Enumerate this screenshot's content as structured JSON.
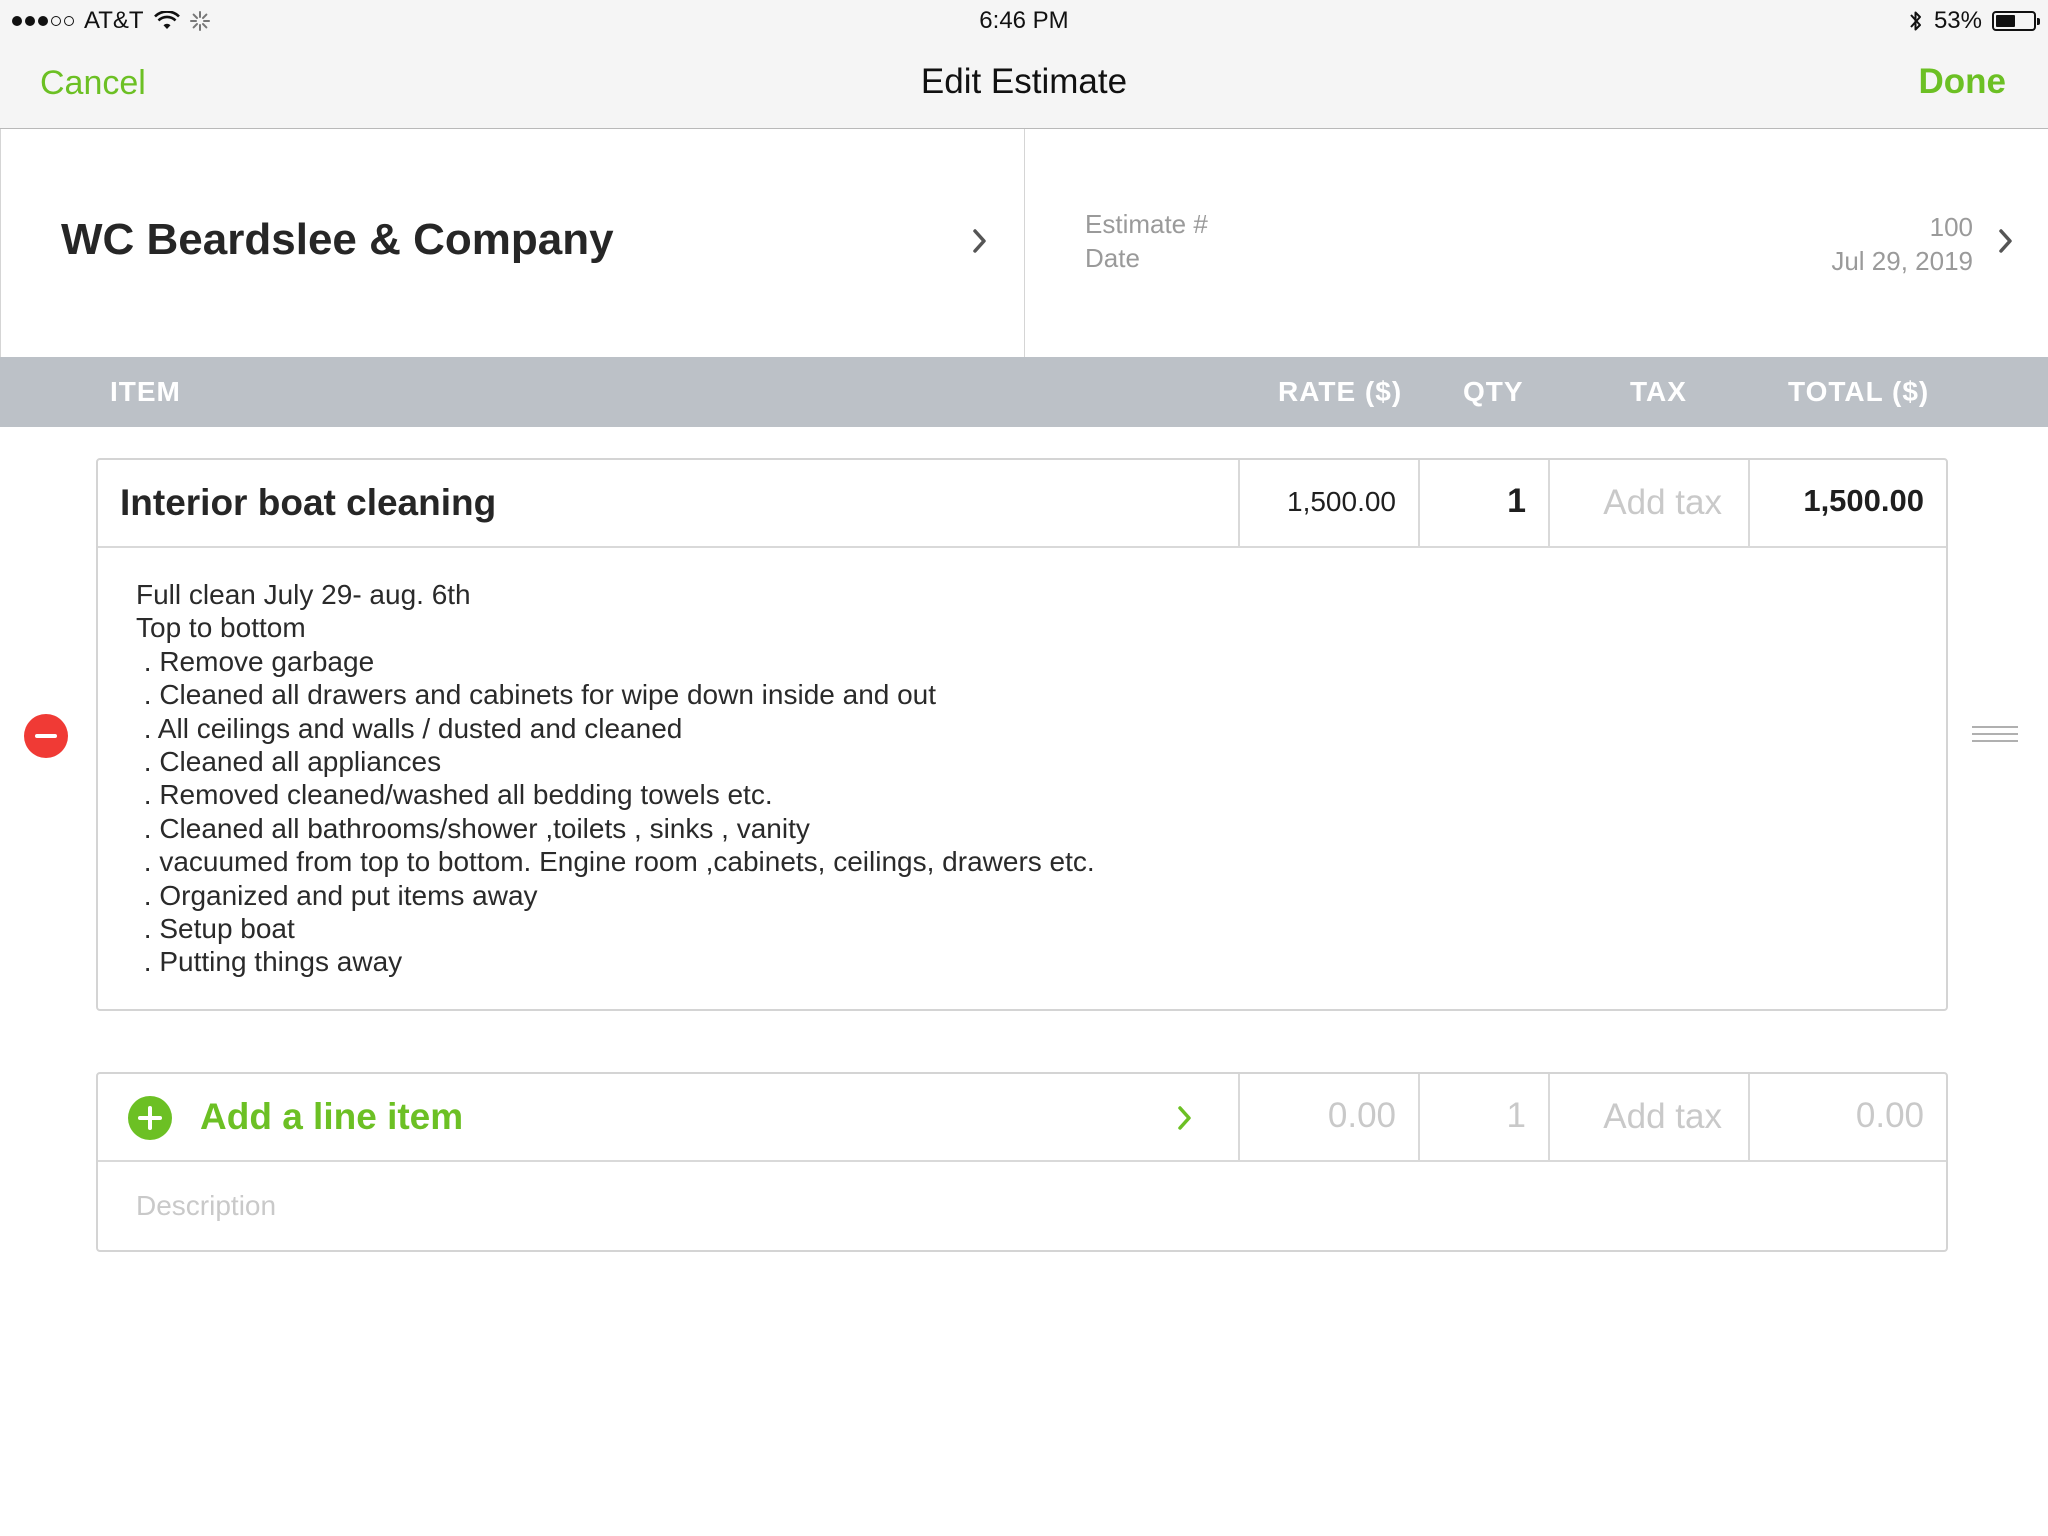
{
  "status_bar": {
    "carrier": "AT&T",
    "time": "6:46 PM",
    "battery_percent": "53%",
    "battery_level": 0.53,
    "icons": [
      "signal-dots-icon",
      "wifi-icon",
      "activity-spinner-icon",
      "bluetooth-icon",
      "battery-icon"
    ]
  },
  "navbar": {
    "cancel_label": "Cancel",
    "title": "Edit Estimate",
    "done_label": "Done"
  },
  "header": {
    "customer_name": "WC Beardslee & Company",
    "estimate_label": "Estimate #",
    "estimate_number": "100",
    "date_label": "Date",
    "date_value": "Jul 29, 2019"
  },
  "columns": {
    "item": "ITEM",
    "rate": "RATE ($)",
    "qty": "QTY",
    "tax": "TAX",
    "total": "TOTAL ($)"
  },
  "line_item": {
    "name": "Interior boat cleaning",
    "rate": "1,500.00",
    "qty": "1",
    "tax_placeholder": "Add tax",
    "total": "1,500.00",
    "description_lines": [
      "Full clean July 29- aug. 6th",
      "Top to bottom",
      " . Remove garbage",
      " . Cleaned all drawers and cabinets for wipe down inside and out",
      " . All ceilings and walls / dusted and cleaned",
      " . Cleaned all appliances",
      " . Removed cleaned/washed all bedding towels etc.",
      " . Cleaned all bathrooms/shower ,toilets , sinks , vanity",
      " . vacuumed from top to bottom. Engine room ,cabinets, ceilings, drawers etc.",
      " . Organized and put items away",
      " . Setup boat",
      " . Putting things away"
    ]
  },
  "new_item": {
    "label": "Add a line item",
    "rate_placeholder": "0.00",
    "qty_placeholder": "1",
    "tax_placeholder": "Add tax",
    "total_placeholder": "0.00",
    "description_placeholder": "Description"
  },
  "colors": {
    "accent": "#6cc024",
    "delete": "#f03a35",
    "column_header_bg": "#bcc1c7"
  }
}
